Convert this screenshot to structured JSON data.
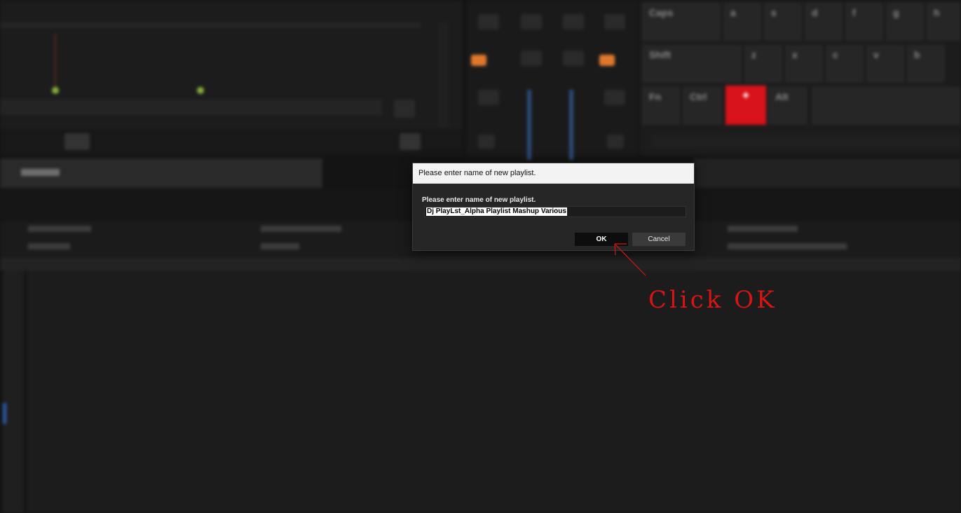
{
  "dialog": {
    "title": "Please enter name of new playlist.",
    "prompt": "Please enter name of new playlist.",
    "input_value": "Dj PlayLst_Alpha Playlist Mashup Various",
    "ok_label": "OK",
    "cancel_label": "Cancel"
  },
  "annotation": {
    "text": "Click OK",
    "color": "#d81414"
  },
  "keyboard": {
    "row1": [
      "Caps",
      "a",
      "s",
      "d",
      "f",
      "g",
      "h"
    ],
    "row2": [
      "Shift",
      "z",
      "x",
      "c",
      "v",
      "b"
    ],
    "row3": [
      "Fn",
      "Ctrl",
      "Alt"
    ]
  },
  "colors": {
    "background": "#141414",
    "accent_orange": "#e0782c",
    "key_highlight": "#d8121a"
  }
}
